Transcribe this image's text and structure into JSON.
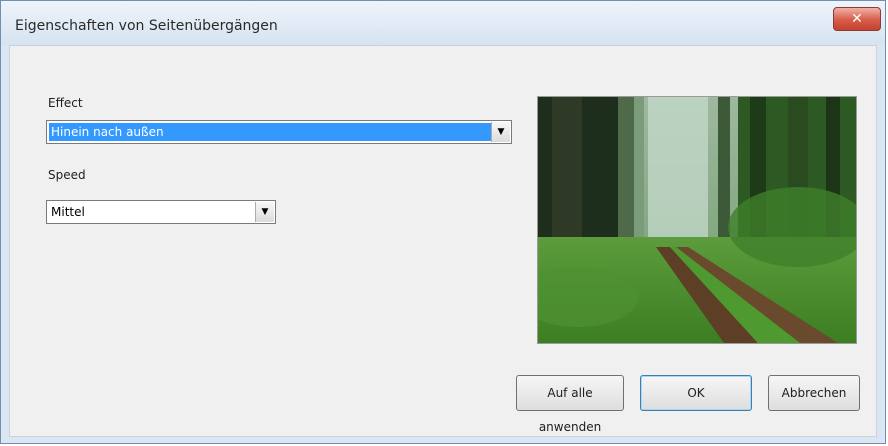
{
  "window": {
    "title": "Eigenschaften von Seitenübergängen",
    "close_label": "✕"
  },
  "effect": {
    "label": "Effect",
    "value": "Hinein nach außen",
    "arrow": "▼"
  },
  "speed": {
    "label": "Speed",
    "value": "Mittel",
    "arrow": "▼"
  },
  "preview": {
    "icon": "forest-path-image"
  },
  "buttons": {
    "apply_all": "Auf alle anwenden",
    "ok": "OK",
    "cancel": "Abbrechen"
  }
}
